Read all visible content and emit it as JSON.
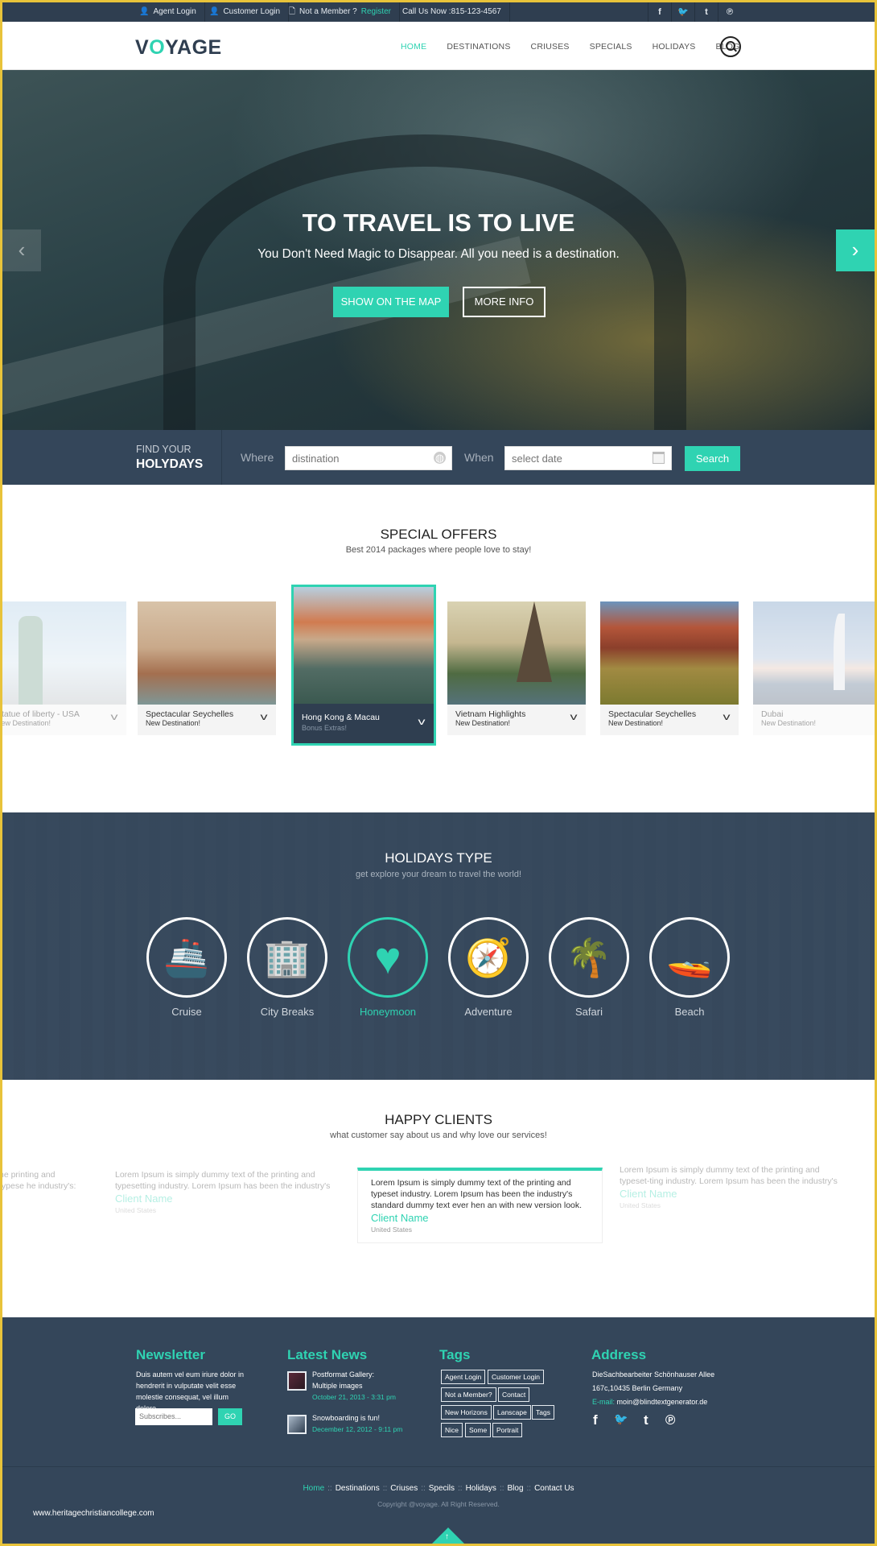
{
  "topbar": {
    "agent_login": "Agent Login",
    "customer_login": "Customer Login",
    "not_member": "Not a Member ?",
    "register": "Register",
    "call_us": "Call Us Now :815-123-4567",
    "social": [
      "f",
      "t-bird",
      "t",
      "p"
    ],
    "social_icons": [
      "facebook-icon",
      "twitter-icon",
      "tumblr-icon",
      "pinterest-icon"
    ]
  },
  "header": {
    "logo_v": "V",
    "logo_o": "O",
    "logo_rest": "YAGE",
    "nav": [
      "HOME",
      "DESTINATIONS",
      "CRIUSES",
      "SPECIALS",
      "HOLIDAYS",
      "BLOG"
    ],
    "active_nav": "HOME"
  },
  "hero": {
    "title": "TO TRAVEL IS TO LIVE",
    "subtitle": "You Don't Need Magic to Disappear. All you need is a destination.",
    "btn_map": "SHOW ON THE MAP",
    "btn_info": "MORE INFO",
    "prev": "‹",
    "next": "›"
  },
  "search": {
    "find_your": "FIND YOUR",
    "holydays": "HOLYDAYS",
    "where_label": "Where",
    "where_placeholder": "distination",
    "when_label": "When",
    "when_placeholder": "select date",
    "button": "Search"
  },
  "special_offers": {
    "title": "SPECIAL OFFERS",
    "subtitle": "Best 2014 packages where people love to stay!",
    "cards": [
      {
        "title": "Statue of liberty - USA",
        "sub": "New Destination!"
      },
      {
        "title": "Spectacular Seychelles",
        "sub": "New Destination!"
      },
      {
        "title": "Hong Kong & Macau",
        "sub": "Bonus Extras!"
      },
      {
        "title": "Vietnam Highlights",
        "sub": "New Destination!"
      },
      {
        "title": "Spectacular Seychelles",
        "sub": "New Destination!"
      },
      {
        "title": "Dubai",
        "sub": "New Destination!"
      }
    ],
    "chevron": "v"
  },
  "holidays_type": {
    "title": "HOLIDAYS TYPE",
    "subtitle": "get explore your dream to travel the world!",
    "items": [
      {
        "label": "Cruise",
        "glyph": "🚢"
      },
      {
        "label": "City Breaks",
        "glyph": "🏢"
      },
      {
        "label": "Honeymoon",
        "glyph": "♥"
      },
      {
        "label": "Adventure",
        "glyph": "🧭"
      },
      {
        "label": "Safari",
        "glyph": "🌴"
      },
      {
        "label": "Beach",
        "glyph": "🚤"
      }
    ],
    "active": "Honeymoon"
  },
  "happy_clients": {
    "title": "HAPPY CLIENTS",
    "subtitle": "what customer say about us and why love our services!",
    "testimonials": [
      {
        "text": "he printing and typese he industry's:",
        "name": "",
        "country": ""
      },
      {
        "text": "Lorem Ipsum is simply dummy text of the printing and typesetting industry. Lorem Ipsum has been the industry's",
        "name": "Client Name",
        "country": "United States"
      },
      {
        "text": "Lorem Ipsum is simply dummy text of the printing and typeset industry. Lorem Ipsum has been the industry's standard dummy text ever hen an with new version look.",
        "name": "Client Name",
        "country": "United States"
      },
      {
        "text": "Lorem Ipsum is simply dummy text of the printing and typeset-ting industry. Lorem Ipsum has been the industry's",
        "name": "Client Name",
        "country": "United States"
      }
    ]
  },
  "footer": {
    "newsletter": {
      "title": "Newsletter",
      "text": "Duis autem vel eum iriure dolor in hendrerit in vulputate velit esse molestie consequat, vel illum dolore.",
      "placeholder": "Subscribes...",
      "button": "GO"
    },
    "news": {
      "title": "Latest News",
      "items": [
        {
          "title": "Postformat Gallery: Multiple images",
          "date": "October 21, 2013 - 3:31 pm"
        },
        {
          "title": "Snowboarding is fun!",
          "date": "December 12, 2012 - 9:11 pm"
        }
      ]
    },
    "tags": {
      "title": "Tags",
      "items": [
        "Agent Login",
        "Customer Login",
        "Not a Member?",
        "Contact",
        "New Horizons",
        "Lanscape",
        "Tags",
        "Nice",
        "Some",
        "Portrait"
      ]
    },
    "address": {
      "title": "Address",
      "line1": "DieSachbearbeiter Schönhauser Allee",
      "line2": "167c,10435 Berlin Germany",
      "email_label": "E-mail:",
      "email": "moin@blindtextgenerator.de",
      "social": [
        "f",
        "🐦",
        "t",
        "℗"
      ]
    },
    "bottom_nav": [
      "Home",
      "Destinations",
      "Criuses",
      "Specils",
      "Holidays",
      "Blog",
      "Contact Us"
    ],
    "separator": "::",
    "copyright": "Copyright @voyage. All Right Reserved.",
    "watermark": "www.heritagechristiancollege.com",
    "to_top": "↑"
  }
}
